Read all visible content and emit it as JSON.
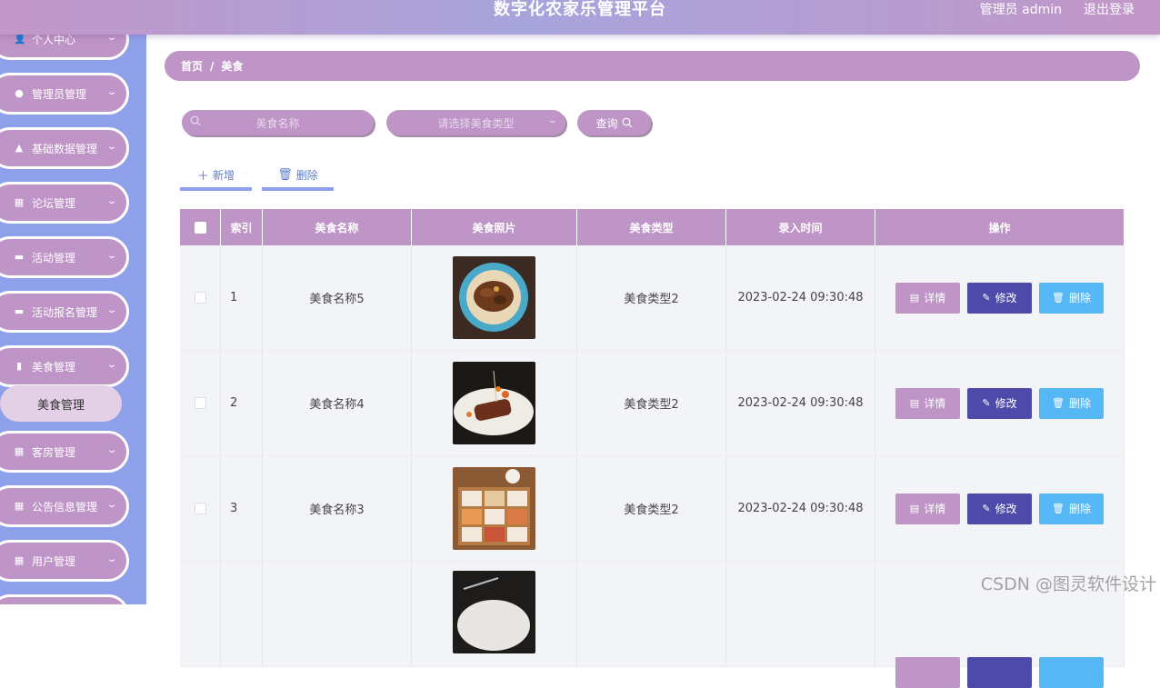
{
  "header": {
    "title": "数字化农家乐管理平台",
    "user": "管理员 admin",
    "logout": "退出登录"
  },
  "sidebar": {
    "items": [
      {
        "label": "个人中心",
        "icon": "user-icon"
      },
      {
        "label": "管理员管理",
        "icon": "pin-icon"
      },
      {
        "label": "基础数据管理",
        "icon": "user-badge-icon"
      },
      {
        "label": "论坛管理",
        "icon": "grid-icon"
      },
      {
        "label": "活动管理",
        "icon": "ticket-icon"
      },
      {
        "label": "活动报名管理",
        "icon": "briefcase-icon"
      },
      {
        "label": "美食管理",
        "icon": "clipboard-icon"
      },
      {
        "label": "客房管理",
        "icon": "grid-icon"
      },
      {
        "label": "公告信息管理",
        "icon": "grid-icon"
      },
      {
        "label": "用户管理",
        "icon": "grid-icon"
      }
    ],
    "active_sub": "美食管理"
  },
  "breadcrumb": {
    "home": "首页",
    "sep": "/",
    "current": "美食"
  },
  "search": {
    "name_placeholder": "美食名称",
    "type_placeholder": "请选择美食类型",
    "query": "查询"
  },
  "toolbar": {
    "add": "新增",
    "delete": "删除"
  },
  "table": {
    "headers": {
      "index": "索引",
      "name": "美食名称",
      "image": "美食照片",
      "type": "美食类型",
      "time": "录入时间",
      "ops": "操作"
    },
    "rows": [
      {
        "index": "1",
        "name": "美食名称5",
        "type": "美食类型2",
        "time": "2023-02-24 09:30:48"
      },
      {
        "index": "2",
        "name": "美食名称4",
        "type": "美食类型2",
        "time": "2023-02-24 09:30:48"
      },
      {
        "index": "3",
        "name": "美食名称3",
        "type": "美食类型2",
        "time": "2023-02-24 09:30:48"
      },
      {
        "index": "",
        "name": "",
        "type": "",
        "time": ""
      }
    ],
    "ops": {
      "detail": "详情",
      "edit": "修改",
      "delete": "删除"
    }
  },
  "watermark": "CSDN @图灵软件设计",
  "colors": {
    "accent": "#bf94c7",
    "sidebar": "#8fa0ea",
    "edit": "#4e4aa9",
    "delete": "#55b7f4"
  }
}
